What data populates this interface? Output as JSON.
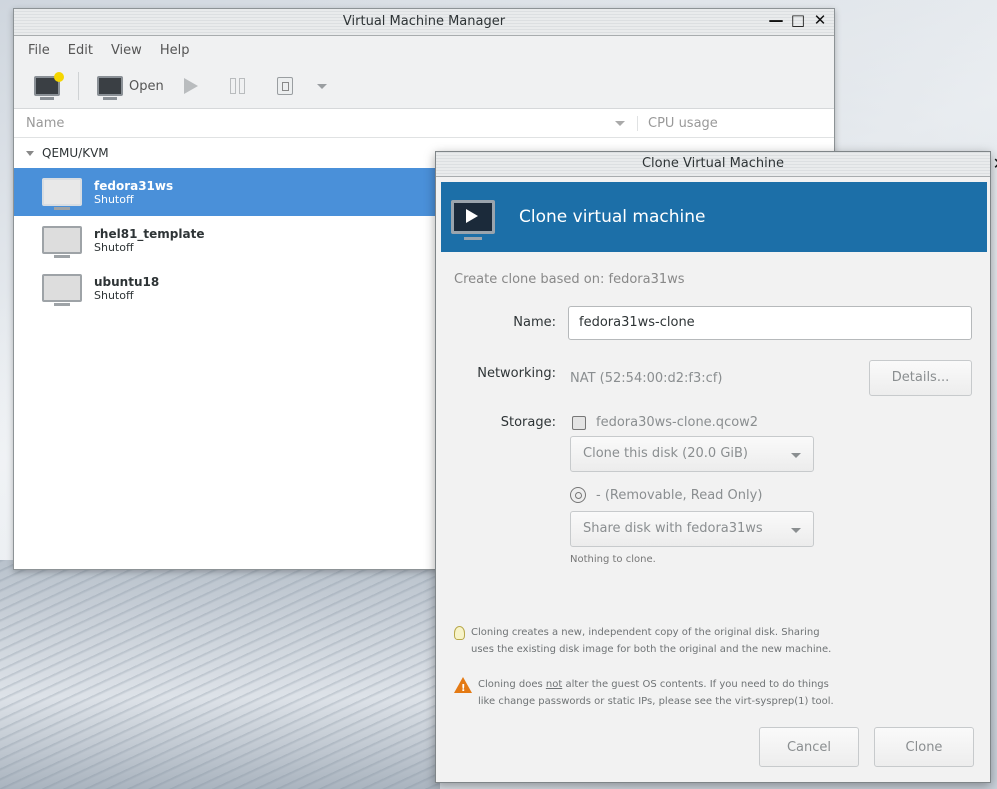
{
  "main_window": {
    "title": "Virtual Machine Manager",
    "menu": [
      "File",
      "Edit",
      "View",
      "Help"
    ],
    "toolbar": {
      "open_label": "Open"
    },
    "columns": {
      "name": "Name",
      "cpu": "CPU usage"
    },
    "group": "QEMU/KVM",
    "vms": [
      {
        "name": "fedora31ws",
        "state": "Shutoff",
        "selected": true
      },
      {
        "name": "rhel81_template",
        "state": "Shutoff",
        "selected": false
      },
      {
        "name": "ubuntu18",
        "state": "Shutoff",
        "selected": false
      }
    ]
  },
  "dialog": {
    "title": "Clone Virtual Machine",
    "banner_title": "Clone virtual machine",
    "base_text": "Create clone based on: fedora31ws",
    "name_label": "Name:",
    "name_value": "fedora31ws-clone",
    "networking_label": "Networking:",
    "networking_value": "NAT (52:54:00:d2:f3:cf)",
    "details_button": "Details...",
    "storage_label": "Storage:",
    "disk1_name": "fedora30ws-clone.qcow2",
    "disk1_action": "Clone this disk (20.0 GiB)",
    "disk2_name": "- (Removable, Read Only)",
    "disk2_action": "Share disk with fedora31ws",
    "nothing_to_clone": "Nothing to clone.",
    "note1_line1": "Cloning creates a new, independent copy of the original disk. Sharing",
    "note1_line2": "uses the existing disk image for both the original and the new machine.",
    "note2_pre": "Cloning does ",
    "note2_not": "not",
    "note2_post": " alter the guest OS contents. If you need to do things",
    "note2_line2": "like change passwords or static IPs, please see the virt-sysprep(1) tool.",
    "cancel_button": "Cancel",
    "clone_button": "Clone",
    "accent_color": "#1c6fa8",
    "selection_color": "#4a90d9"
  }
}
